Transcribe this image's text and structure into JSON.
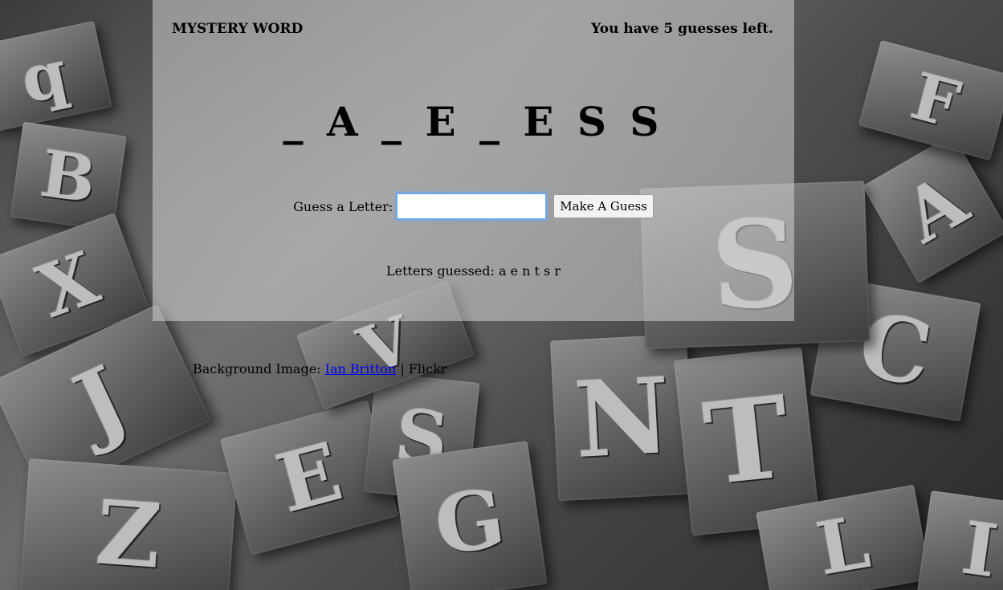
{
  "header": {
    "title": "MYSTERY WORD",
    "guesses_left_text": "You have 5 guesses left."
  },
  "game": {
    "word_display": "_ A _ E _ E S S",
    "guess_label": "Guess a Letter:",
    "guess_input_value": "",
    "guess_button_label": "Make A Guess",
    "letters_guessed_label": "Letters guessed:",
    "letters_guessed_value": "a e n t s r"
  },
  "footer": {
    "credit_prefix": "Background Image:",
    "credit_link": "Ian Britton",
    "credit_suffix": "| Flickr"
  },
  "colors": {
    "link": "#0000ee",
    "input_focus": "#6aa7ec",
    "panel": "rgba(210,210,210,0.55)"
  }
}
